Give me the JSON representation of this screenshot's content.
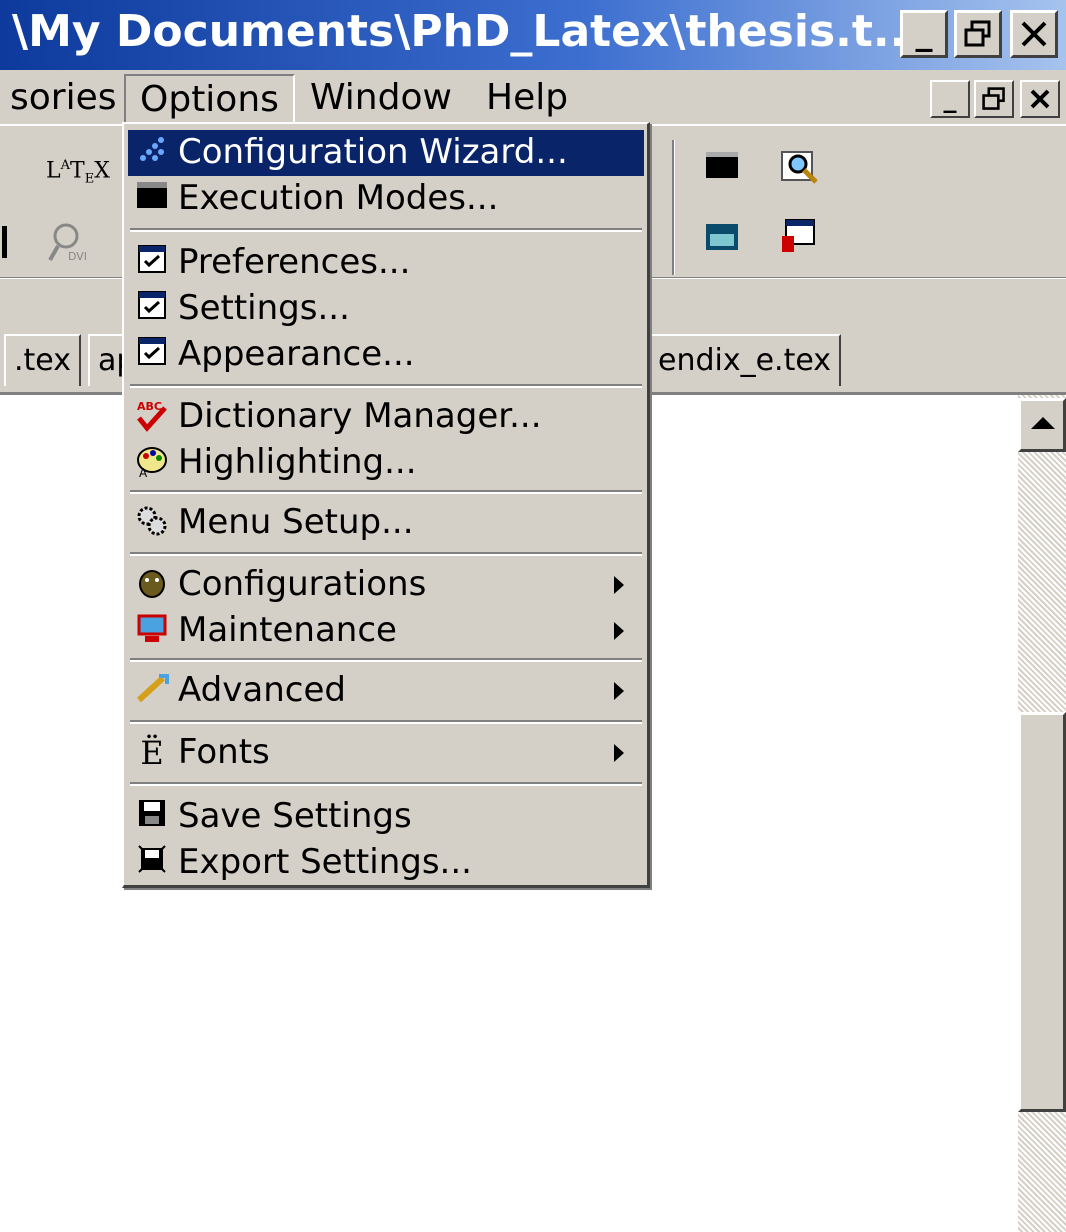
{
  "window": {
    "title": "\\My Documents\\PhD_Latex\\thesis.t...",
    "minimize": "_",
    "restore": "🗗",
    "close": "✕"
  },
  "menubar": {
    "items": [
      {
        "label": "sories"
      },
      {
        "label": "Options"
      },
      {
        "label": "Window"
      },
      {
        "label": "Help"
      }
    ],
    "doc_minimize": "_",
    "doc_restore": "🗗",
    "doc_close": "✕"
  },
  "toolbar": {
    "icons": [
      "latex-icon",
      "dvi-icon",
      "view-icon",
      "search-icon",
      "calculator-icon",
      "window-icon"
    ]
  },
  "tabs": [
    {
      "label": ".tex"
    },
    {
      "label": "ap"
    },
    {
      "label": "endix_e.tex"
    }
  ],
  "options_menu": {
    "groups": [
      [
        {
          "label": "Configuration Wizard...",
          "icon": "wizard-icon",
          "highlighted": true
        },
        {
          "label": "Execution Modes...",
          "icon": "execution-icon"
        }
      ],
      [
        {
          "label": "Preferences...",
          "icon": "preferences-icon"
        },
        {
          "label": "Settings...",
          "icon": "settings-icon"
        },
        {
          "label": "Appearance...",
          "icon": "appearance-icon"
        }
      ],
      [
        {
          "label": "Dictionary Manager...",
          "icon": "spellcheck-icon"
        },
        {
          "label": "Highlighting...",
          "icon": "palette-icon"
        }
      ],
      [
        {
          "label": "Menu Setup...",
          "icon": "gears-icon"
        }
      ],
      [
        {
          "label": "Configurations",
          "icon": "configurations-icon",
          "submenu": true
        },
        {
          "label": "Maintenance",
          "icon": "maintenance-icon",
          "submenu": true
        }
      ],
      [
        {
          "label": "Advanced",
          "icon": "advanced-icon",
          "submenu": true
        }
      ],
      [
        {
          "label": "Fonts",
          "icon": "fonts-icon",
          "submenu": true
        }
      ],
      [
        {
          "label": "Save Settings",
          "icon": "save-icon"
        },
        {
          "label": "Export Settings...",
          "icon": "export-icon"
        }
      ]
    ]
  }
}
